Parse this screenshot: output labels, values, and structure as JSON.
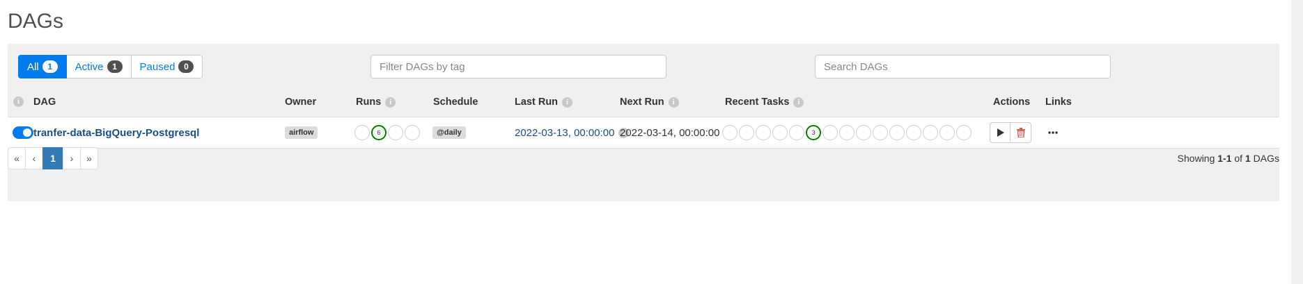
{
  "page": {
    "title": "DAGs"
  },
  "filters": [
    {
      "label": "All",
      "count": "1",
      "active": true
    },
    {
      "label": "Active",
      "count": "1",
      "active": false
    },
    {
      "label": "Paused",
      "count": "0",
      "active": false
    }
  ],
  "tag_filter": {
    "placeholder": "Filter DAGs by tag"
  },
  "search": {
    "placeholder": "Search DAGs"
  },
  "columns": {
    "dag": "DAG",
    "owner": "Owner",
    "runs": "Runs",
    "schedule": "Schedule",
    "last_run": "Last Run",
    "next_run": "Next Run",
    "recent_tasks": "Recent Tasks",
    "actions": "Actions",
    "links": "Links"
  },
  "info_icon": "i",
  "dags": [
    {
      "dag_id": "tranfer-data-BigQuery-Postgresql",
      "enabled": true,
      "owner": "airflow",
      "runs": [
        "",
        "6",
        "",
        ""
      ],
      "runs_success_index": 1,
      "schedule": "@daily",
      "last_run": "2022-03-13, 00:00:00",
      "next_run": "2022-03-14, 00:00:00",
      "recent_tasks": [
        "",
        "",
        "",
        "",
        "",
        "3",
        "",
        "",
        "",
        "",
        "",
        "",
        "",
        "",
        ""
      ],
      "recent_tasks_success_index": 5
    }
  ],
  "pagination": {
    "first": "«",
    "prev": "‹",
    "current": "1",
    "next": "›",
    "last": "»"
  },
  "showing": {
    "prefix": "Showing ",
    "range": "1-1",
    "of": " of ",
    "total": "1",
    "suffix": " DAGs"
  },
  "colors": {
    "primary": "#017cee",
    "success": "#008000",
    "danger": "#d9534f",
    "dag_link": "#1c4e80"
  },
  "icons": {
    "trigger": "play-icon",
    "delete": "trash-icon",
    "more": "more-horizontal-icon",
    "toggle": "toggle-switch-icon"
  }
}
